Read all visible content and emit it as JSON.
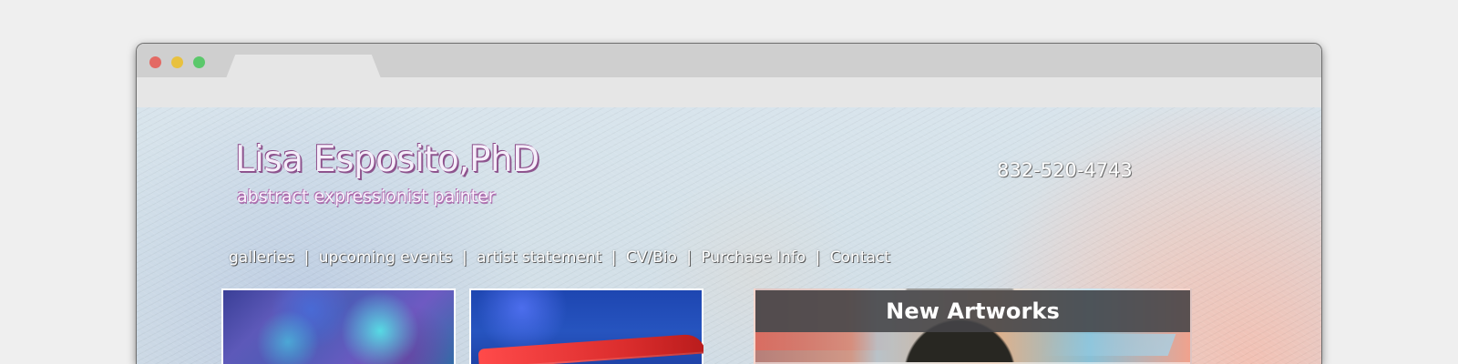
{
  "site": {
    "title": "Lisa Esposito,PhD",
    "subtitle": "abstract expressionist painter",
    "phone": "832-520-4743"
  },
  "navigation": {
    "items": [
      "galleries",
      "upcoming events",
      "artist statement",
      "CV/Bio",
      "Purchase Info",
      "Contact"
    ],
    "separator": "|"
  },
  "featured": {
    "title": "New Artworks"
  },
  "colors": {
    "page_background": "#efefef",
    "title_outline": "#8b4c89",
    "subtitle_outline": "#b06eb0",
    "traffic_red": "#e36a64",
    "traffic_yellow": "#e8c13f",
    "traffic_green": "#5bc86b"
  }
}
